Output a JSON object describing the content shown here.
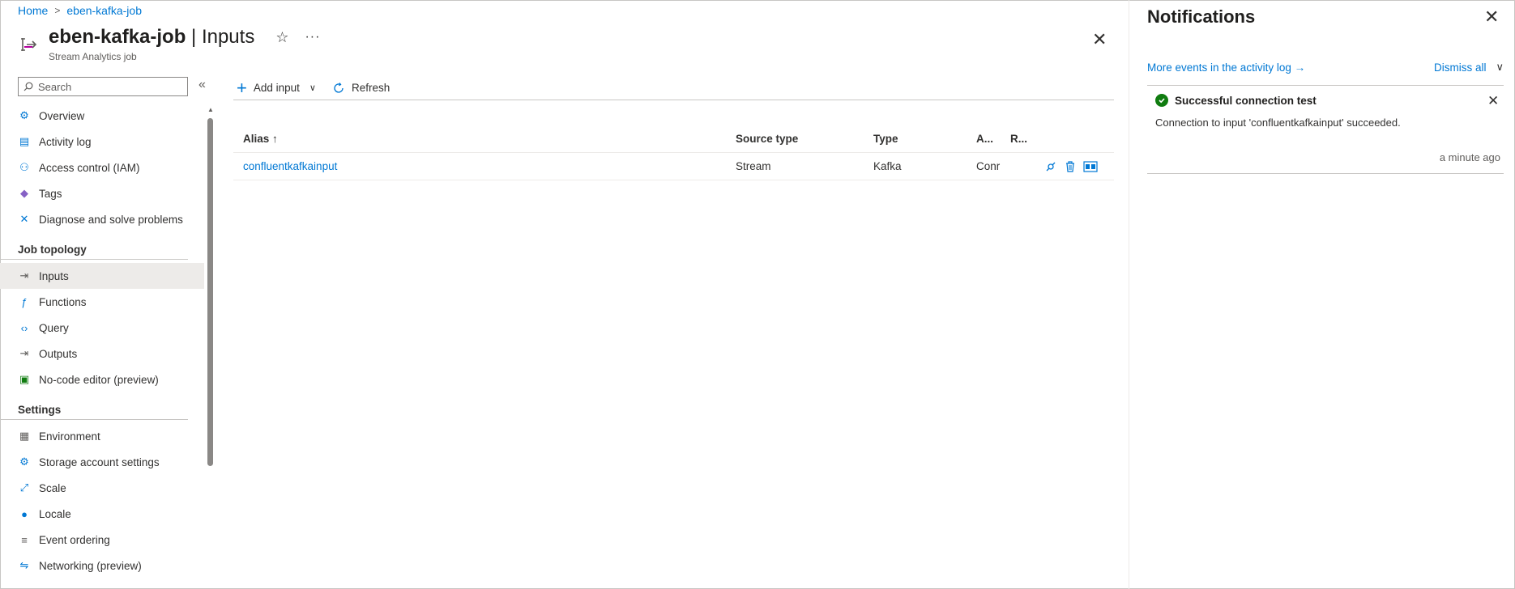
{
  "breadcrumb": {
    "home": "Home",
    "job": "eben-kafka-job"
  },
  "header": {
    "title": "eben-kafka-job",
    "title_suffix": " | Inputs",
    "subtitle": "Stream Analytics job",
    "more": "···"
  },
  "search": {
    "placeholder": "Search"
  },
  "nav": {
    "items_top": [
      {
        "label": "Overview",
        "icon": "gear-icon"
      },
      {
        "label": "Activity log",
        "icon": "activity-log-icon"
      },
      {
        "label": "Access control (IAM)",
        "icon": "people-icon"
      },
      {
        "label": "Tags",
        "icon": "tag-icon"
      },
      {
        "label": "Diagnose and solve problems",
        "icon": "wrench-icon"
      }
    ],
    "section_job_topology": "Job topology",
    "items_topology": [
      {
        "label": "Inputs",
        "icon": "input-icon"
      },
      {
        "label": "Functions",
        "icon": "function-icon"
      },
      {
        "label": "Query",
        "icon": "code-icon"
      },
      {
        "label": "Outputs",
        "icon": "output-icon"
      },
      {
        "label": "No-code editor (preview)",
        "icon": "no-code-icon"
      }
    ],
    "section_settings": "Settings",
    "items_settings": [
      {
        "label": "Environment",
        "icon": "environment-icon"
      },
      {
        "label": "Storage account settings",
        "icon": "gear-icon"
      },
      {
        "label": "Scale",
        "icon": "scale-icon"
      },
      {
        "label": "Locale",
        "icon": "globe-icon"
      },
      {
        "label": "Event ordering",
        "icon": "event-ordering-icon"
      },
      {
        "label": "Networking (preview)",
        "icon": "network-icon"
      }
    ]
  },
  "toolbar": {
    "add_input": "Add input",
    "refresh": "Refresh"
  },
  "table": {
    "headers": {
      "alias": "Alias ↑",
      "source_type": "Source type",
      "type": "Type",
      "a": "A...",
      "r": "R..."
    },
    "rows": [
      {
        "alias": "confluentkafkainput",
        "source_type": "Stream",
        "type": "Kafka",
        "a": "Conr"
      }
    ]
  },
  "notifications": {
    "title": "Notifications",
    "activity_link": "More events in the activity log →",
    "dismiss_all": "Dismiss all",
    "card": {
      "title": "Successful connection test",
      "message": "Connection to input 'confluentkafkainput' succeeded.",
      "time": "a minute ago",
      "status_color": "#107c10"
    }
  },
  "colors": {
    "accent": "#0078d4",
    "active_nav": "#edebe9"
  }
}
